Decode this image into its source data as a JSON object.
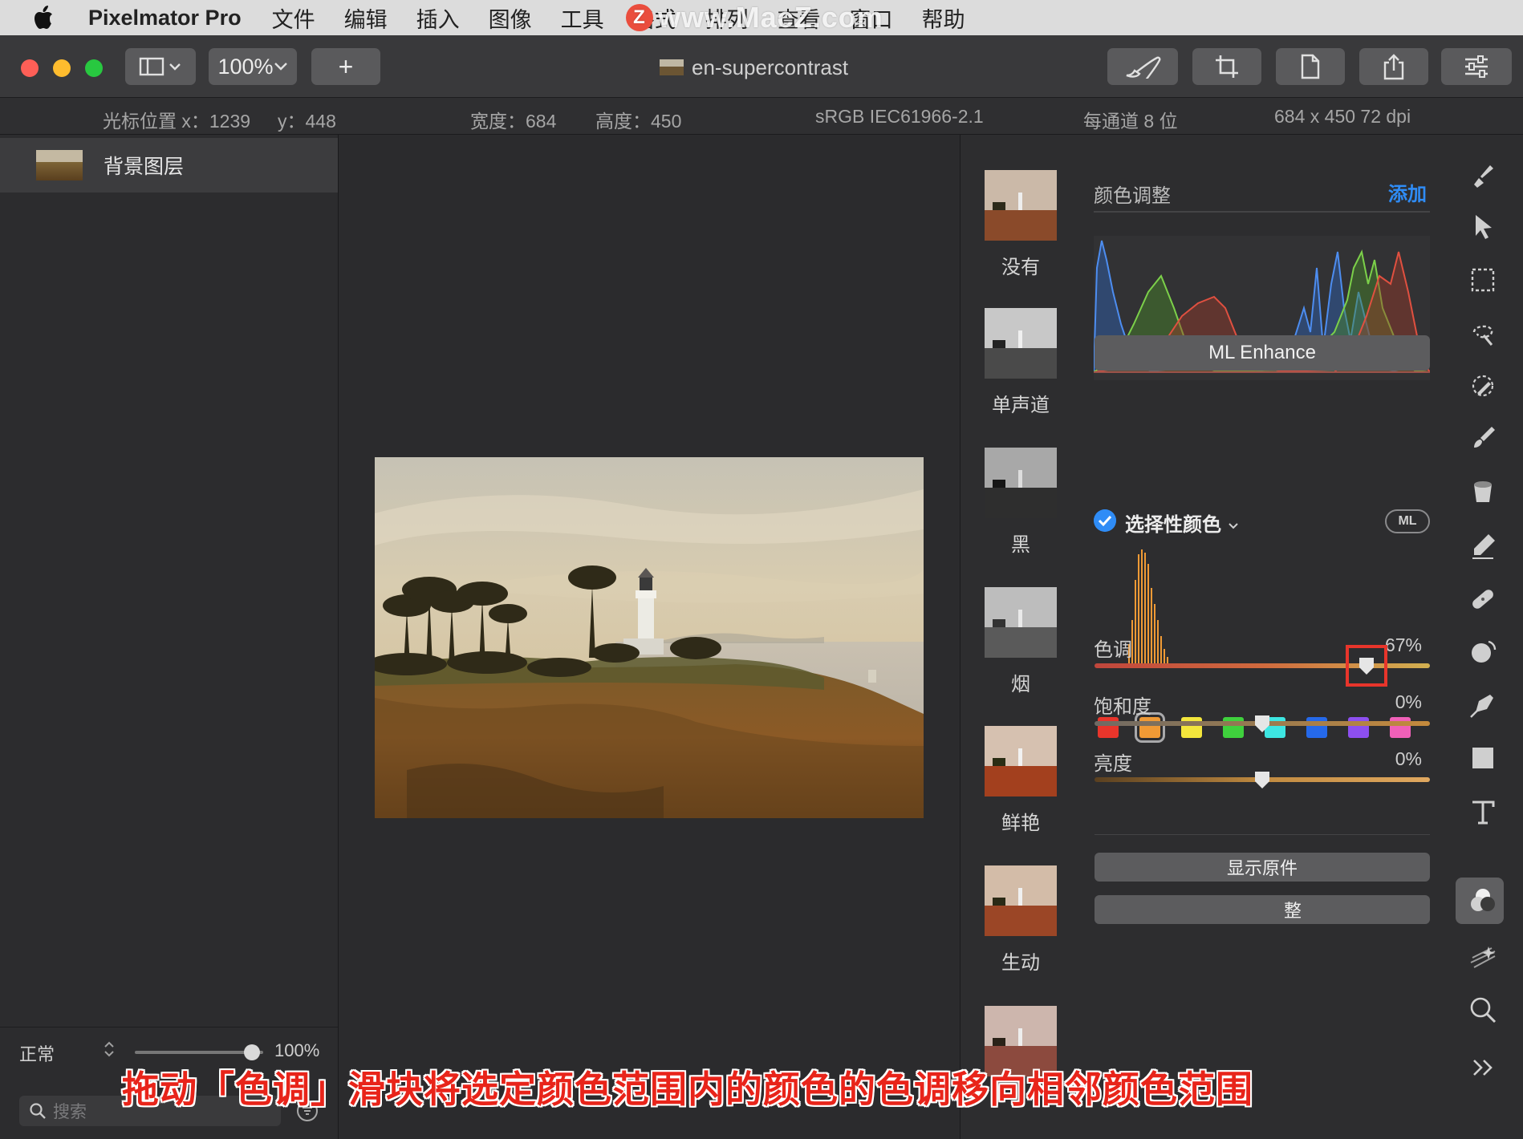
{
  "menubar": {
    "app_name": "Pixelmator Pro",
    "items": [
      "文件",
      "编辑",
      "插入",
      "图像",
      "工具",
      "格式",
      "排列",
      "查看",
      "窗口",
      "帮助"
    ],
    "watermark": "www.MacZ.com"
  },
  "toolbar": {
    "zoom": "100%",
    "add_label": "+",
    "document_title": "en-supercontrast"
  },
  "infobar": {
    "cursor_x": "光标位置 x：1239",
    "cursor_y": "y：448",
    "width": "宽度：684",
    "height": "高度：450",
    "color_profile": "sRGB IEC61966-2.1",
    "bit_depth": "每通道 8 位",
    "dimensions": "684 x 450 72 dpi"
  },
  "layers": {
    "items": [
      {
        "name": "背景图层"
      }
    ],
    "blend_mode": "正常",
    "opacity": "100%",
    "opacity_level": 1.0,
    "search_placeholder": "搜索"
  },
  "presets": {
    "items": [
      {
        "label": "没有"
      },
      {
        "label": "单声道"
      },
      {
        "label": "黑"
      },
      {
        "label": "烟"
      },
      {
        "label": "鲜艳"
      },
      {
        "label": "生动"
      },
      {
        "label": ""
      }
    ]
  },
  "adjustments": {
    "section_title": "颜色调整",
    "add_label": "添加",
    "ml_enhance_label": "ML Enhance",
    "selective_color_title": "选择性颜色",
    "ml_badge": "ML",
    "swatches": [
      "#e8352b",
      "#f09a35",
      "#f3e63c",
      "#3fd13d",
      "#3de6e2",
      "#2569ea",
      "#8d4ff0",
      "#f060b8"
    ],
    "selected_swatch": 1,
    "sliders": [
      {
        "label": "色调",
        "value": "67%",
        "level": 0.81
      },
      {
        "label": "饱和度",
        "value": "0%",
        "level": 0.5
      },
      {
        "label": "亮度",
        "value": "0%",
        "level": 0.5
      }
    ],
    "show_original_label": "显示原件",
    "reset_label": "整"
  },
  "tools": [
    "paint-brush-icon",
    "arrow-pointer-icon",
    "rect-select-icon",
    "lasso-icon",
    "color-picker-icon",
    "brush-icon",
    "bucket-icon",
    "eraser-icon",
    "bandage-icon",
    "distort-icon",
    "pen-icon",
    "shape-icon",
    "text-icon",
    "color-adjust-icon",
    "effects-icon",
    "zoom-icon",
    "more-icon"
  ],
  "caption": "拖动「色调」滑块将选定颜色范围内的颜色的色调移向相邻颜色范围",
  "colors": {
    "accent": "#2f8cf6",
    "highlight": "#e8352b",
    "caption": "#e8241a"
  }
}
